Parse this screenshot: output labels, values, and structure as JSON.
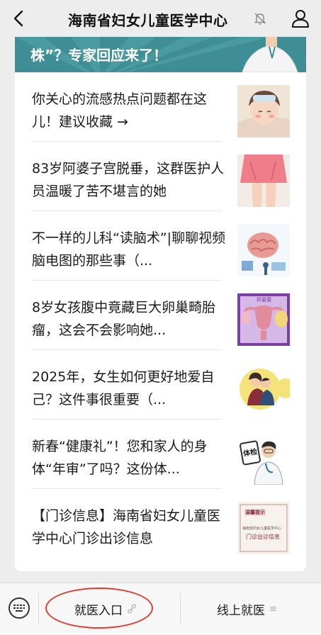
{
  "header": {
    "title": "海南省妇女儿童医学中心",
    "back_icon": "chevron-left-icon",
    "mute_icon": "bell-off-icon",
    "profile_icon": "person-icon"
  },
  "banner": {
    "text": "株”？专家回应来了！",
    "color": "#3f8e95"
  },
  "articles": [
    {
      "title": "你关心的流感热点问题都在这儿！建议收藏 →",
      "thumb": "sick-girl-thumbnail"
    },
    {
      "title": "83岁阿婆子宫脱垂，这群医护人员温暖了苦不堪言的她",
      "thumb": "pink-skirt-legs-thumbnail"
    },
    {
      "title": "不一样的儿科“读脑术”|聊聊视频脑电图的那些事（...",
      "thumb": "brain-illustration-thumbnail"
    },
    {
      "title": "8岁女孩腹中竟藏巨大卵巢畸胎瘤，这会不会影响她...",
      "thumb": "uterus-ovary-thumbnail"
    },
    {
      "title": "2025年，女生如何更好地爱自己？这件事很重要（...",
      "thumb": "couple-circle-thumbnail"
    },
    {
      "title": "新春“健康礼”！您和家人的身体“年审”了吗？这份体...",
      "thumb": "doctor-checkup-thumbnail"
    },
    {
      "title": "【门诊信息】海南省妇女儿童医学中心门诊出诊信息",
      "thumb": "clinic-notice-thumbnail"
    }
  ],
  "thumbs_text": {
    "uterus_label": "卵巢瘤",
    "checkup_label": "体检",
    "notice_heading": "温馨提示",
    "notice_org": "海南省妇女儿童医学中心",
    "notice_body": "门诊出诊信息"
  },
  "bottom_bar": {
    "keyboard_icon": "keyboard-icon",
    "menu1_label": "就医入口",
    "menu1_suffix": "🔗",
    "menu2_label": "线上就医",
    "menu2_suffix": "≡"
  },
  "annotation_color": "#e23a2e"
}
